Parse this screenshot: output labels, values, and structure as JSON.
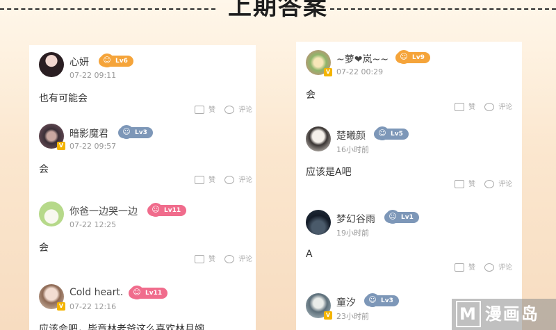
{
  "header": {
    "title": "上期答案"
  },
  "colors": {
    "lv_orange": "#f5a43a",
    "lv_blue": "#7d97b8",
    "lv_pink": "#f06c8c",
    "vip_badge": "#f4b400"
  },
  "actions": {
    "like": "赞",
    "comment": "评论"
  },
  "left_comments": [
    {
      "user": "心妍",
      "level": "Lv6",
      "time": "07-22 09:11",
      "text": "也有可能会",
      "vip": false
    },
    {
      "user": "暗影魔君",
      "level": "Lv3",
      "time": "07-22 09:57",
      "text": "会",
      "vip": true
    },
    {
      "user": "你爸一边哭一边",
      "level": "Lv11",
      "time": "07-22 12:25",
      "text": "会",
      "vip": false
    },
    {
      "user": "Cold heart.",
      "level": "Lv11",
      "time": "07-22 12:16",
      "text": "应该会吧，毕竟林老爸这么喜欢林月婉",
      "vip": true
    }
  ],
  "right_comments": [
    {
      "user": "~萝❤岚~~",
      "level": "Lv9",
      "time": "07-22 00:29",
      "text": "会",
      "vip": true
    },
    {
      "user": "楚曦颜",
      "level": "Lv5",
      "time": "16小时前",
      "text": "应该是A吧",
      "vip": false
    },
    {
      "user": "梦幻谷雨",
      "level": "Lv1",
      "time": "19小时前",
      "text": "A",
      "vip": false
    },
    {
      "user": "童汐",
      "level": "Lv3",
      "time": "23小时前",
      "text": "",
      "vip": true
    }
  ],
  "watermark": {
    "logo": "M",
    "text": "漫画岛"
  }
}
